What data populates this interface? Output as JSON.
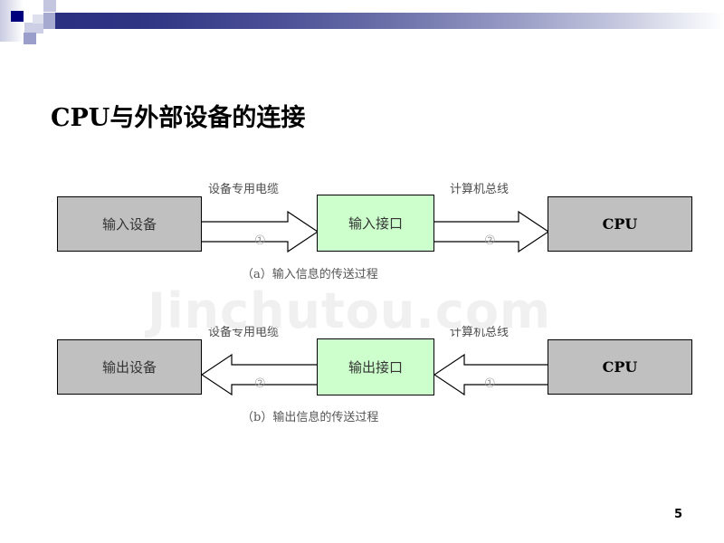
{
  "slide": {
    "title": "CPU与外部设备的连接",
    "page_number": "5",
    "watermark": "Jinchutou.com"
  },
  "theme": {
    "band_dark": "#2b2f7f",
    "band_light": "#ffffff",
    "accent_navy": "#00007c",
    "accent_lavender": "#a7aad0",
    "device_box_fill": "#c0c0c0",
    "interface_box_fill": "#ccffcc",
    "box_border": "#000000",
    "label_color": "#4d4d4d",
    "number_color": "#9a9a9a"
  },
  "diagram": {
    "rows": [
      {
        "id": "input-flow",
        "caption": "（a）输入信息的传送过程",
        "source_box": {
          "label": "输入设备",
          "fill": "gray"
        },
        "interface_box": {
          "label": "输入接口",
          "fill": "green"
        },
        "target_box": {
          "label": "CPU",
          "fill": "gray"
        },
        "link_left": {
          "label": "设备专用电缆",
          "marker": "①",
          "direction": "right"
        },
        "link_right": {
          "label": "计算机总线",
          "marker": "②",
          "direction": "right"
        }
      },
      {
        "id": "output-flow",
        "caption": "（b）输出信息的传送过程",
        "source_box": {
          "label": "输出设备",
          "fill": "gray"
        },
        "interface_box": {
          "label": "输出接口",
          "fill": "green"
        },
        "target_box": {
          "label": "CPU",
          "fill": "gray"
        },
        "link_left": {
          "label": "设备专用电缆",
          "marker": "②",
          "direction": "left"
        },
        "link_right": {
          "label": "计算机总线",
          "marker": "①",
          "direction": "left"
        }
      }
    ]
  }
}
